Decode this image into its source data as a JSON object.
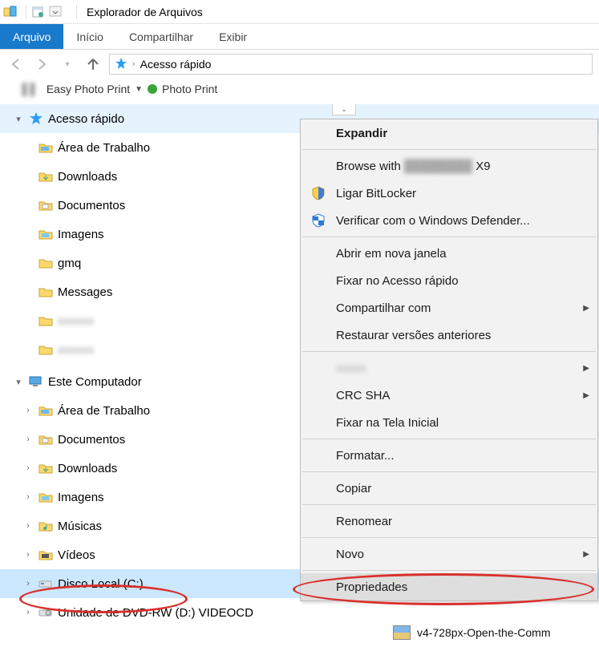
{
  "window": {
    "title": "Explorador de Arquivos"
  },
  "ribbon": {
    "file": "Arquivo",
    "home": "Início",
    "share": "Compartilhar",
    "view": "Exibir"
  },
  "addressbar": {
    "location": "Acesso rápido"
  },
  "extrabar": {
    "item1": "Easy Photo Print",
    "item2": "Photo Print"
  },
  "tree": {
    "quick_access": "Acesso rápido",
    "desktop": "Área de Trabalho",
    "downloads": "Downloads",
    "documents": "Documentos",
    "images": "Imagens",
    "gmq": "gmq",
    "messages": "Messages",
    "hidden1": "xxxxxx",
    "hidden2": "xxxxxx",
    "this_pc": "Este Computador",
    "pc_desktop": "Área de Trabalho",
    "pc_documents": "Documentos",
    "pc_downloads": "Downloads",
    "pc_images": "Imagens",
    "pc_music": "Músicas",
    "pc_videos": "Vídeos",
    "local_disk": "Disco Local (C:)",
    "dvd": "Unidade de DVD-RW (D:) VIDEOCD"
  },
  "context_menu": {
    "expand": "Expandir",
    "browse_with": "Browse with",
    "browse_suffix": "X9",
    "bitlocker": "Ligar BitLocker",
    "defender": "Verificar com o Windows Defender...",
    "new_window": "Abrir em nova janela",
    "pin_quick": "Fixar no Acesso rápido",
    "share_with": "Compartilhar com",
    "restore": "Restaurar versões anteriores",
    "hidden": "xxxxx",
    "crc": "CRC SHA",
    "pin_start": "Fixar na Tela Inicial",
    "format": "Formatar...",
    "copy": "Copiar",
    "rename": "Renomear",
    "new": "Novo",
    "properties": "Propriedades"
  },
  "file_item": {
    "name": "v4-728px-Open-the-Comm"
  }
}
